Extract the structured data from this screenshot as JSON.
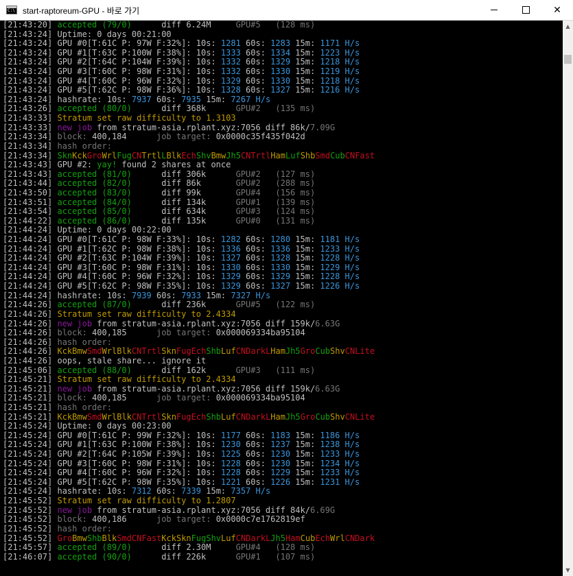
{
  "window": {
    "title": "start-raptoreum-GPU - 바로 가기",
    "app_icon": "console-icon",
    "minimize_icon": "minimize-icon",
    "maximize_icon": "maximize-icon",
    "close_glyph": "✕",
    "scroll_up_glyph": "▲",
    "scroll_down_glyph": "▼"
  },
  "colors": {
    "w": "#c0c0c0",
    "g": "#13a10e",
    "y": "#c19c00",
    "c": "#3a96dd",
    "m": "#881798",
    "r": "#c50f1f",
    "d": "#767676",
    "bg": "#000000"
  },
  "lines": [
    [
      [
        "w",
        "[21:43:20] "
      ],
      [
        "g",
        "accepted (79/0)"
      ],
      [
        "w",
        "      diff 6.24M     "
      ],
      [
        "d",
        "GPU#5   (128 ms)"
      ]
    ],
    [
      [
        "w",
        "[21:43:24] Uptime: 0 days 00:21:00"
      ]
    ],
    [
      [
        "w",
        "[21:43:24] GPU #0[T:61C P: 97W F:32%]: 10s: "
      ],
      [
        "c",
        "1281"
      ],
      [
        "w",
        " 60s: "
      ],
      [
        "c",
        "1283"
      ],
      [
        "w",
        " 15m: "
      ],
      [
        "c",
        "1171 H/s"
      ]
    ],
    [
      [
        "w",
        "[21:43:24] GPU #1[T:63C P:100W F:38%]: 10s: "
      ],
      [
        "c",
        "1333"
      ],
      [
        "w",
        " 60s: "
      ],
      [
        "c",
        "1334"
      ],
      [
        "w",
        " 15m: "
      ],
      [
        "c",
        "1223 H/s"
      ]
    ],
    [
      [
        "w",
        "[21:43:24] GPU #2[T:64C P:104W F:39%]: 10s: "
      ],
      [
        "c",
        "1332"
      ],
      [
        "w",
        " 60s: "
      ],
      [
        "c",
        "1329"
      ],
      [
        "w",
        " 15m: "
      ],
      [
        "c",
        "1218 H/s"
      ]
    ],
    [
      [
        "w",
        "[21:43:24] GPU #3[T:60C P: 98W F:31%]: 10s: "
      ],
      [
        "c",
        "1332"
      ],
      [
        "w",
        " 60s: "
      ],
      [
        "c",
        "1330"
      ],
      [
        "w",
        " 15m: "
      ],
      [
        "c",
        "1219 H/s"
      ]
    ],
    [
      [
        "w",
        "[21:43:24] GPU #4[T:60C P: 96W F:32%]: 10s: "
      ],
      [
        "c",
        "1329"
      ],
      [
        "w",
        " 60s: "
      ],
      [
        "c",
        "1330"
      ],
      [
        "w",
        " 15m: "
      ],
      [
        "c",
        "1218 H/s"
      ]
    ],
    [
      [
        "w",
        "[21:43:24] GPU #5[T:62C P: 98W F:36%]: 10s: "
      ],
      [
        "c",
        "1328"
      ],
      [
        "w",
        " 60s: "
      ],
      [
        "c",
        "1327"
      ],
      [
        "w",
        " 15m: "
      ],
      [
        "c",
        "1216 H/s"
      ]
    ],
    [
      [
        "w",
        "[21:43:24] hashrate: 10s: "
      ],
      [
        "c",
        "7937"
      ],
      [
        "w",
        " 60s: "
      ],
      [
        "c",
        "7935"
      ],
      [
        "w",
        " 15m: "
      ],
      [
        "c",
        "7267 H/s"
      ]
    ],
    [
      [
        "w",
        "[21:43:26] "
      ],
      [
        "g",
        "accepted (80/0)"
      ],
      [
        "w",
        "      diff 368k      "
      ],
      [
        "d",
        "GPU#2   (135 ms)"
      ]
    ],
    [
      [
        "w",
        "[21:43:33] "
      ],
      [
        "y",
        "Stratum set raw difficulty to 1.3103"
      ]
    ],
    [
      [
        "w",
        "[21:43:33] "
      ],
      [
        "m",
        "new job"
      ],
      [
        "w",
        " from stratum-asia.rplant.xyz:7056 diff 86k/"
      ],
      [
        "d",
        "7.09G"
      ]
    ],
    [
      [
        "w",
        "[21:43:34] "
      ],
      [
        "d",
        "block: "
      ],
      [
        "w",
        "400,184      "
      ],
      [
        "d",
        "job target: "
      ],
      [
        "w",
        "0x0000c35f435f042d"
      ]
    ],
    [
      [
        "w",
        "[21:43:34] "
      ],
      [
        "d",
        "hash order:"
      ]
    ],
    [
      [
        "w",
        "[21:43:34] "
      ],
      [
        "g",
        "Skn"
      ],
      [
        "y",
        "Kck"
      ],
      [
        "r",
        "Gro"
      ],
      [
        "y",
        "Wrl"
      ],
      [
        "g",
        "Fug"
      ],
      [
        "r",
        "CN"
      ],
      [
        "y",
        "Trtl"
      ],
      [
        "g",
        "L"
      ],
      [
        "y",
        "Blk"
      ],
      [
        "r",
        "Ech"
      ],
      [
        "g",
        "Shv"
      ],
      [
        "y",
        "Bmw"
      ],
      [
        "g",
        "Jh5"
      ],
      [
        "r",
        "CNTrtl"
      ],
      [
        "y",
        "Ham"
      ],
      [
        "g",
        "Luf"
      ],
      [
        "y",
        "Shb"
      ],
      [
        "r",
        "Smd"
      ],
      [
        "g",
        "Cub"
      ],
      [
        "r",
        "CNFast"
      ]
    ],
    [
      [
        "w",
        "[21:43:43] GPU #2: "
      ],
      [
        "g",
        "yay!"
      ],
      [
        "w",
        " found 2 shares at once"
      ]
    ],
    [
      [
        "w",
        "[21:43:43] "
      ],
      [
        "g",
        "accepted (81/0)"
      ],
      [
        "w",
        "      diff 306k      "
      ],
      [
        "d",
        "GPU#2   (127 ms)"
      ]
    ],
    [
      [
        "w",
        "[21:43:44] "
      ],
      [
        "g",
        "accepted (82/0)"
      ],
      [
        "w",
        "      diff 86k       "
      ],
      [
        "d",
        "GPU#2   (288 ms)"
      ]
    ],
    [
      [
        "w",
        "[21:43:50] "
      ],
      [
        "g",
        "accepted (83/0)"
      ],
      [
        "w",
        "      diff 99k       "
      ],
      [
        "d",
        "GPU#4   (156 ms)"
      ]
    ],
    [
      [
        "w",
        "[21:43:51] "
      ],
      [
        "g",
        "accepted (84/0)"
      ],
      [
        "w",
        "      diff 134k      "
      ],
      [
        "d",
        "GPU#1   (139 ms)"
      ]
    ],
    [
      [
        "w",
        "[21:43:54] "
      ],
      [
        "g",
        "accepted (85/0)"
      ],
      [
        "w",
        "      diff 634k      "
      ],
      [
        "d",
        "GPU#3   (124 ms)"
      ]
    ],
    [
      [
        "w",
        "[21:44:22] "
      ],
      [
        "g",
        "accepted (86/0)"
      ],
      [
        "w",
        "      diff 135k      "
      ],
      [
        "d",
        "GPU#0   (131 ms)"
      ]
    ],
    [
      [
        "w",
        "[21:44:24] Uptime: 0 days 00:22:00"
      ]
    ],
    [
      [
        "w",
        "[21:44:24] GPU #0[T:61C P: 98W F:33%]: 10s: "
      ],
      [
        "c",
        "1282"
      ],
      [
        "w",
        " 60s: "
      ],
      [
        "c",
        "1280"
      ],
      [
        "w",
        " 15m: "
      ],
      [
        "c",
        "1181 H/s"
      ]
    ],
    [
      [
        "w",
        "[21:44:24] GPU #1[T:62C P: 98W F:38%]: 10s: "
      ],
      [
        "c",
        "1336"
      ],
      [
        "w",
        " 60s: "
      ],
      [
        "c",
        "1336"
      ],
      [
        "w",
        " 15m: "
      ],
      [
        "c",
        "1233 H/s"
      ]
    ],
    [
      [
        "w",
        "[21:44:24] GPU #2[T:63C P:104W F:39%]: 10s: "
      ],
      [
        "c",
        "1327"
      ],
      [
        "w",
        " 60s: "
      ],
      [
        "c",
        "1328"
      ],
      [
        "w",
        " 15m: "
      ],
      [
        "c",
        "1228 H/s"
      ]
    ],
    [
      [
        "w",
        "[21:44:24] GPU #3[T:60C P: 98W F:31%]: 10s: "
      ],
      [
        "c",
        "1330"
      ],
      [
        "w",
        " 60s: "
      ],
      [
        "c",
        "1330"
      ],
      [
        "w",
        " 15m: "
      ],
      [
        "c",
        "1229 H/s"
      ]
    ],
    [
      [
        "w",
        "[21:44:24] GPU #4[T:60C P: 96W F:32%]: 10s: "
      ],
      [
        "c",
        "1329"
      ],
      [
        "w",
        " 60s: "
      ],
      [
        "c",
        "1329"
      ],
      [
        "w",
        " 15m: "
      ],
      [
        "c",
        "1228 H/s"
      ]
    ],
    [
      [
        "w",
        "[21:44:24] GPU #5[T:62C P: 98W F:35%]: 10s: "
      ],
      [
        "c",
        "1329"
      ],
      [
        "w",
        " 60s: "
      ],
      [
        "c",
        "1327"
      ],
      [
        "w",
        " 15m: "
      ],
      [
        "c",
        "1226 H/s"
      ]
    ],
    [
      [
        "w",
        "[21:44:24] hashrate: 10s: "
      ],
      [
        "c",
        "7939"
      ],
      [
        "w",
        " 60s: "
      ],
      [
        "c",
        "7933"
      ],
      [
        "w",
        " 15m: "
      ],
      [
        "c",
        "7327 H/s"
      ]
    ],
    [
      [
        "w",
        "[21:44:26] "
      ],
      [
        "g",
        "accepted (87/0)"
      ],
      [
        "w",
        "      diff 236k      "
      ],
      [
        "d",
        "GPU#5   (122 ms)"
      ]
    ],
    [
      [
        "w",
        "[21:44:26] "
      ],
      [
        "y",
        "Stratum set raw difficulty to 2.4334"
      ]
    ],
    [
      [
        "w",
        "[21:44:26] "
      ],
      [
        "m",
        "new job"
      ],
      [
        "w",
        " from stratum-asia.rplant.xyz:7056 diff 159k/"
      ],
      [
        "d",
        "6.63G"
      ]
    ],
    [
      [
        "w",
        "[21:44:26] "
      ],
      [
        "d",
        "block: "
      ],
      [
        "w",
        "400,185      "
      ],
      [
        "d",
        "job target: "
      ],
      [
        "w",
        "0x000069334ba95104"
      ]
    ],
    [
      [
        "w",
        "[21:44:26] "
      ],
      [
        "d",
        "hash order:"
      ]
    ],
    [
      [
        "w",
        "[21:44:26] "
      ],
      [
        "y",
        "Kck"
      ],
      [
        "y",
        "Bmw"
      ],
      [
        "r",
        "Smd"
      ],
      [
        "y",
        "Wrl"
      ],
      [
        "y",
        "Blk"
      ],
      [
        "r",
        "CNTrtl"
      ],
      [
        "y",
        "Skn"
      ],
      [
        "r",
        "Fug"
      ],
      [
        "r",
        "Ech"
      ],
      [
        "g",
        "Shb"
      ],
      [
        "y",
        "Luf"
      ],
      [
        "r",
        "CNDarkL"
      ],
      [
        "y",
        "Ham"
      ],
      [
        "g",
        "Jh5"
      ],
      [
        "r",
        "Gro"
      ],
      [
        "g",
        "Cub"
      ],
      [
        "y",
        "Shv"
      ],
      [
        "r",
        "CNLite"
      ]
    ],
    [
      [
        "w",
        "[21:44:26] oops, stale share... ignore it"
      ]
    ],
    [
      [
        "w",
        "[21:45:06] "
      ],
      [
        "g",
        "accepted (88/0)"
      ],
      [
        "w",
        "      diff 162k      "
      ],
      [
        "d",
        "GPU#3   (111 ms)"
      ]
    ],
    [
      [
        "w",
        "[21:45:21] "
      ],
      [
        "y",
        "Stratum set raw difficulty to 2.4334"
      ]
    ],
    [
      [
        "w",
        "[21:45:21] "
      ],
      [
        "m",
        "new job"
      ],
      [
        "w",
        " from stratum-asia.rplant.xyz:7056 diff 159k/"
      ],
      [
        "d",
        "6.63G"
      ]
    ],
    [
      [
        "w",
        "[21:45:21] "
      ],
      [
        "d",
        "block: "
      ],
      [
        "w",
        "400,185      "
      ],
      [
        "d",
        "job target: "
      ],
      [
        "w",
        "0x000069334ba95104"
      ]
    ],
    [
      [
        "w",
        "[21:45:21] "
      ],
      [
        "d",
        "hash order:"
      ]
    ],
    [
      [
        "w",
        "[21:45:21] "
      ],
      [
        "y",
        "Kck"
      ],
      [
        "y",
        "Bmw"
      ],
      [
        "r",
        "Smd"
      ],
      [
        "y",
        "Wrl"
      ],
      [
        "y",
        "Blk"
      ],
      [
        "r",
        "CNTrtl"
      ],
      [
        "y",
        "Skn"
      ],
      [
        "r",
        "Fug"
      ],
      [
        "r",
        "Ech"
      ],
      [
        "g",
        "Shb"
      ],
      [
        "y",
        "Luf"
      ],
      [
        "r",
        "CNDarkL"
      ],
      [
        "y",
        "Ham"
      ],
      [
        "g",
        "Jh5"
      ],
      [
        "r",
        "Gro"
      ],
      [
        "g",
        "Cub"
      ],
      [
        "y",
        "Shv"
      ],
      [
        "r",
        "CNLite"
      ]
    ],
    [
      [
        "w",
        "[21:45:24] Uptime: 0 days 00:23:00"
      ]
    ],
    [
      [
        "w",
        "[21:45:24] GPU #0[T:61C P: 99W F:32%]: 10s: "
      ],
      [
        "c",
        "1177"
      ],
      [
        "w",
        " 60s: "
      ],
      [
        "c",
        "1183"
      ],
      [
        "w",
        " 15m: "
      ],
      [
        "c",
        "1186 H/s"
      ]
    ],
    [
      [
        "w",
        "[21:45:24] GPU #1[T:63C P:100W F:38%]: 10s: "
      ],
      [
        "c",
        "1230"
      ],
      [
        "w",
        " 60s: "
      ],
      [
        "c",
        "1237"
      ],
      [
        "w",
        " 15m: "
      ],
      [
        "c",
        "1238 H/s"
      ]
    ],
    [
      [
        "w",
        "[21:45:24] GPU #2[T:64C P:105W F:39%]: 10s: "
      ],
      [
        "c",
        "1225"
      ],
      [
        "w",
        " 60s: "
      ],
      [
        "c",
        "1230"
      ],
      [
        "w",
        " 15m: "
      ],
      [
        "c",
        "1233 H/s"
      ]
    ],
    [
      [
        "w",
        "[21:45:24] GPU #3[T:60C P: 98W F:31%]: 10s: "
      ],
      [
        "c",
        "1228"
      ],
      [
        "w",
        " 60s: "
      ],
      [
        "c",
        "1230"
      ],
      [
        "w",
        " 15m: "
      ],
      [
        "c",
        "1234 H/s"
      ]
    ],
    [
      [
        "w",
        "[21:45:24] GPU #4[T:60C P: 96W F:32%]: 10s: "
      ],
      [
        "c",
        "1228"
      ],
      [
        "w",
        " 60s: "
      ],
      [
        "c",
        "1229"
      ],
      [
        "w",
        " 15m: "
      ],
      [
        "c",
        "1233 H/s"
      ]
    ],
    [
      [
        "w",
        "[21:45:24] GPU #5[T:62C P: 98W F:35%]: 10s: "
      ],
      [
        "c",
        "1221"
      ],
      [
        "w",
        " 60s: "
      ],
      [
        "c",
        "1226"
      ],
      [
        "w",
        " 15m: "
      ],
      [
        "c",
        "1231 H/s"
      ]
    ],
    [
      [
        "w",
        "[21:45:24] hashrate: 10s: "
      ],
      [
        "c",
        "7312"
      ],
      [
        "w",
        " 60s: "
      ],
      [
        "c",
        "7339"
      ],
      [
        "w",
        " 15m: "
      ],
      [
        "c",
        "7357 H/s"
      ]
    ],
    [
      [
        "w",
        "[21:45:52] "
      ],
      [
        "y",
        "Stratum set raw difficulty to 1.2807"
      ]
    ],
    [
      [
        "w",
        "[21:45:52] "
      ],
      [
        "m",
        "new job"
      ],
      [
        "w",
        " from stratum-asia.rplant.xyz:7056 diff 84k/"
      ],
      [
        "d",
        "6.69G"
      ]
    ],
    [
      [
        "w",
        "[21:45:52] "
      ],
      [
        "d",
        "block: "
      ],
      [
        "w",
        "400,186      "
      ],
      [
        "d",
        "job target: "
      ],
      [
        "w",
        "0x0000c7e1762819ef"
      ]
    ],
    [
      [
        "w",
        "[21:45:52] "
      ],
      [
        "d",
        "hash order:"
      ]
    ],
    [
      [
        "w",
        "[21:45:52] "
      ],
      [
        "r",
        "Gro"
      ],
      [
        "y",
        "Bmw"
      ],
      [
        "g",
        "Shb"
      ],
      [
        "y",
        "Blk"
      ],
      [
        "r",
        "Smd"
      ],
      [
        "r",
        "CNFast"
      ],
      [
        "y",
        "Kck"
      ],
      [
        "y",
        "Skn"
      ],
      [
        "g",
        "Fug"
      ],
      [
        "g",
        "Shv"
      ],
      [
        "y",
        "Luf"
      ],
      [
        "r",
        "CNDarkL"
      ],
      [
        "g",
        "Jh5"
      ],
      [
        "r",
        "Ham"
      ],
      [
        "y",
        "Cub"
      ],
      [
        "r",
        "Ech"
      ],
      [
        "y",
        "Wrl"
      ],
      [
        "r",
        "CNDark"
      ]
    ],
    [
      [
        "w",
        "[21:45:57] "
      ],
      [
        "g",
        "accepted (89/0)"
      ],
      [
        "w",
        "      diff 2.30M     "
      ],
      [
        "d",
        "GPU#4   (128 ms)"
      ]
    ],
    [
      [
        "w",
        "[21:46:07] "
      ],
      [
        "g",
        "accepted (90/0)"
      ],
      [
        "w",
        "      diff 226k      "
      ],
      [
        "d",
        "GPU#1   (107 ms)"
      ]
    ]
  ]
}
